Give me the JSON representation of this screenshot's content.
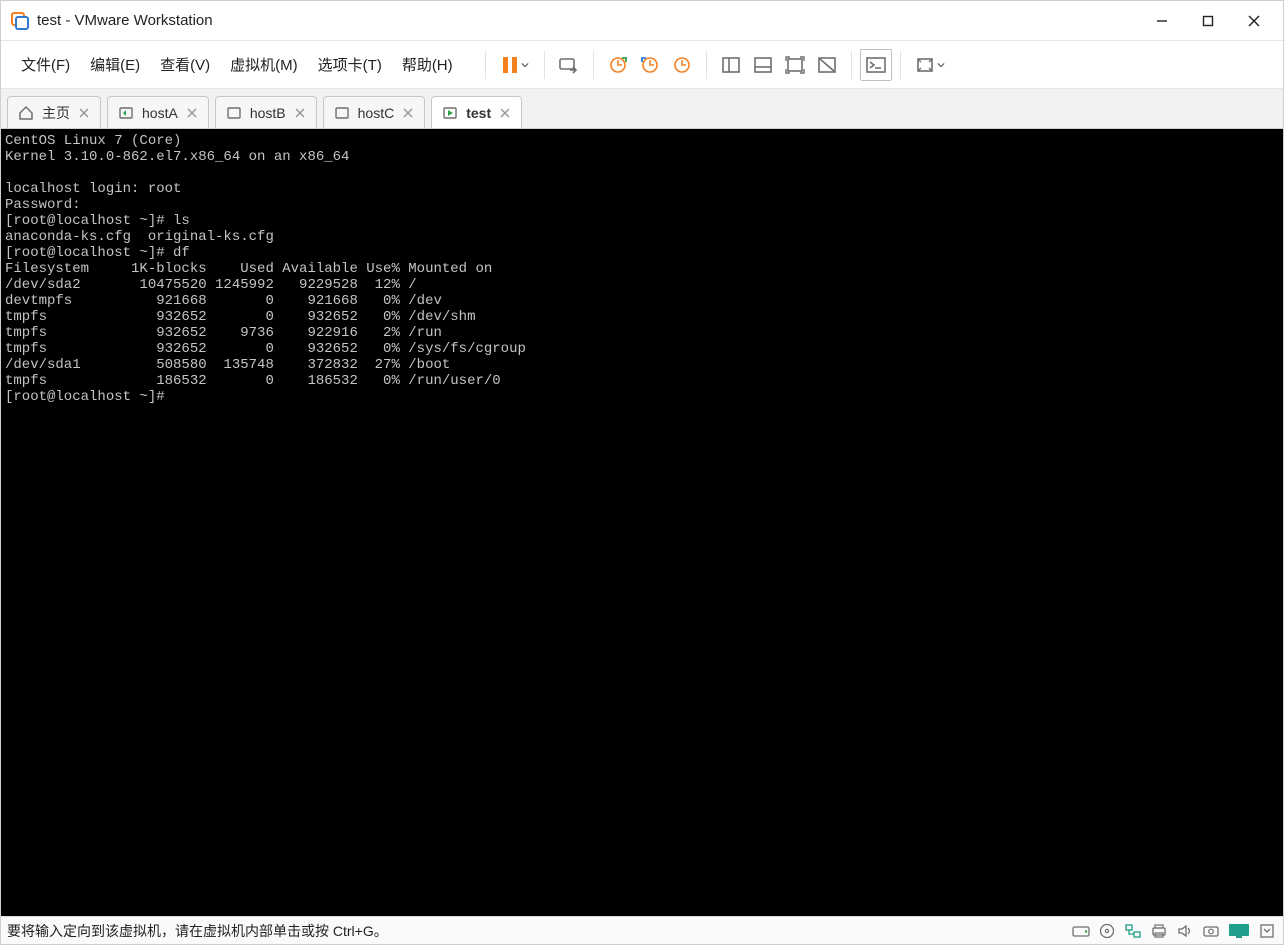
{
  "window": {
    "title": "test - VMware Workstation"
  },
  "menu": {
    "file": "文件(F)",
    "edit": "编辑(E)",
    "view": "查看(V)",
    "vm": "虚拟机(M)",
    "tabs": "选项卡(T)",
    "help": "帮助(H)"
  },
  "colors": {
    "pause_orange": "#f58020",
    "vm_green": "#2fa24a",
    "vm_teal": "#1f9f8b",
    "icon_gray": "#6f6f6f"
  },
  "tabs": {
    "home": "主页",
    "hostA": "hostA",
    "hostB": "hostB",
    "hostC": "hostC",
    "test": "test"
  },
  "terminal": {
    "lines": [
      "CentOS Linux 7 (Core)",
      "Kernel 3.10.0-862.el7.x86_64 on an x86_64",
      "",
      "localhost login: root",
      "Password:",
      "[root@localhost ~]# ls",
      "anaconda-ks.cfg  original-ks.cfg",
      "[root@localhost ~]# df",
      "Filesystem     1K-blocks    Used Available Use% Mounted on",
      "/dev/sda2       10475520 1245992   9229528  12% /",
      "devtmpfs          921668       0    921668   0% /dev",
      "tmpfs             932652       0    932652   0% /dev/shm",
      "tmpfs             932652    9736    922916   2% /run",
      "tmpfs             932652       0    932652   0% /sys/fs/cgroup",
      "/dev/sda1         508580  135748    372832  27% /boot",
      "tmpfs             186532       0    186532   0% /run/user/0",
      "[root@localhost ~]# "
    ]
  },
  "statusbar": {
    "message": "要将输入定向到该虚拟机，请在虚拟机内部单击或按 Ctrl+G。"
  }
}
